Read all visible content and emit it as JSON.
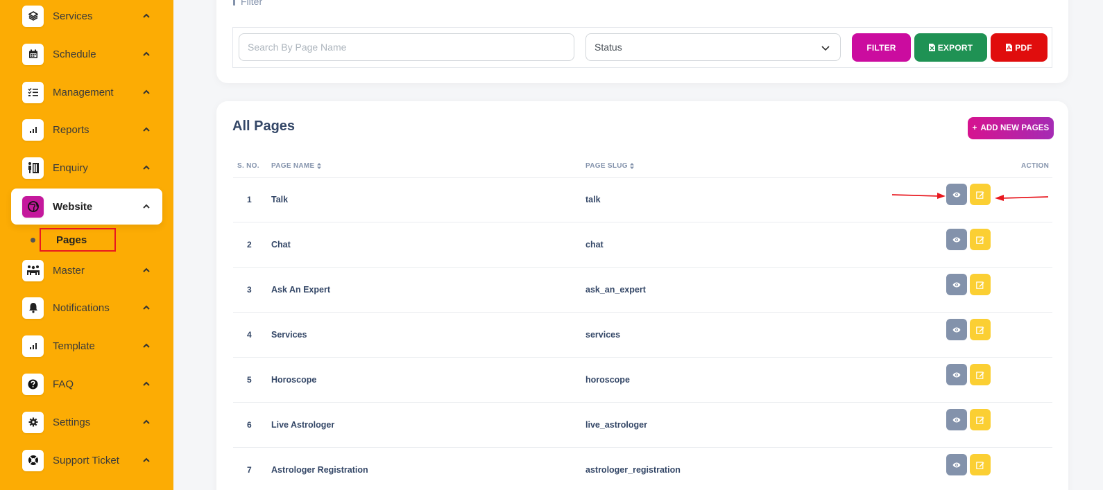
{
  "sidebar": {
    "items": [
      {
        "label": "Services",
        "icon": "layers-icon"
      },
      {
        "label": "Schedule",
        "icon": "calendar-icon"
      },
      {
        "label": "Management",
        "icon": "checklist-icon"
      },
      {
        "label": "Reports",
        "icon": "bar-chart-icon"
      },
      {
        "label": "Enquiry",
        "icon": "enquiry-icon"
      },
      {
        "label": "Website",
        "icon": "website-icon"
      },
      {
        "label": "Master",
        "icon": "users-icon"
      },
      {
        "label": "Notifications",
        "icon": "bell-icon"
      },
      {
        "label": "Template",
        "icon": "bar-chart-icon"
      },
      {
        "label": "FAQ",
        "icon": "question-icon"
      },
      {
        "label": "Settings",
        "icon": "gear-icon"
      },
      {
        "label": "Support Ticket",
        "icon": "lifebuoy-icon"
      }
    ],
    "sub_item": {
      "label": "Pages"
    }
  },
  "filter": {
    "title": "Filter",
    "search_placeholder": "Search By Page Name",
    "status_value": "Status",
    "filter_label": "FILTER",
    "export_label": "EXPORT",
    "pdf_label": "PDF"
  },
  "table": {
    "title": "All Pages",
    "add_label": "ADD NEW PAGES",
    "headers": {
      "sno": "S. NO.",
      "name": "PAGE NAME",
      "slug": "PAGE SLUG",
      "action": "ACTION"
    },
    "rows": [
      {
        "sno": "1",
        "name": "Talk",
        "slug": "talk"
      },
      {
        "sno": "2",
        "name": "Chat",
        "slug": "chat"
      },
      {
        "sno": "3",
        "name": "Ask An Expert",
        "slug": "ask_an_expert"
      },
      {
        "sno": "4",
        "name": "Services",
        "slug": "services"
      },
      {
        "sno": "5",
        "name": "Horoscope",
        "slug": "horoscope"
      },
      {
        "sno": "6",
        "name": "Live Astrologer",
        "slug": "live_astrologer"
      },
      {
        "sno": "7",
        "name": "Astrologer Registration",
        "slug": "astrologer_registration"
      }
    ]
  },
  "colors": {
    "sidebar_bg": "#fcac04",
    "brand": "#cb0c9f",
    "export": "#1f9254",
    "pdf": "#e00d0d",
    "view_btn": "#8392ab",
    "edit_btn": "#fbcf33",
    "annotation": "#e8181f"
  }
}
